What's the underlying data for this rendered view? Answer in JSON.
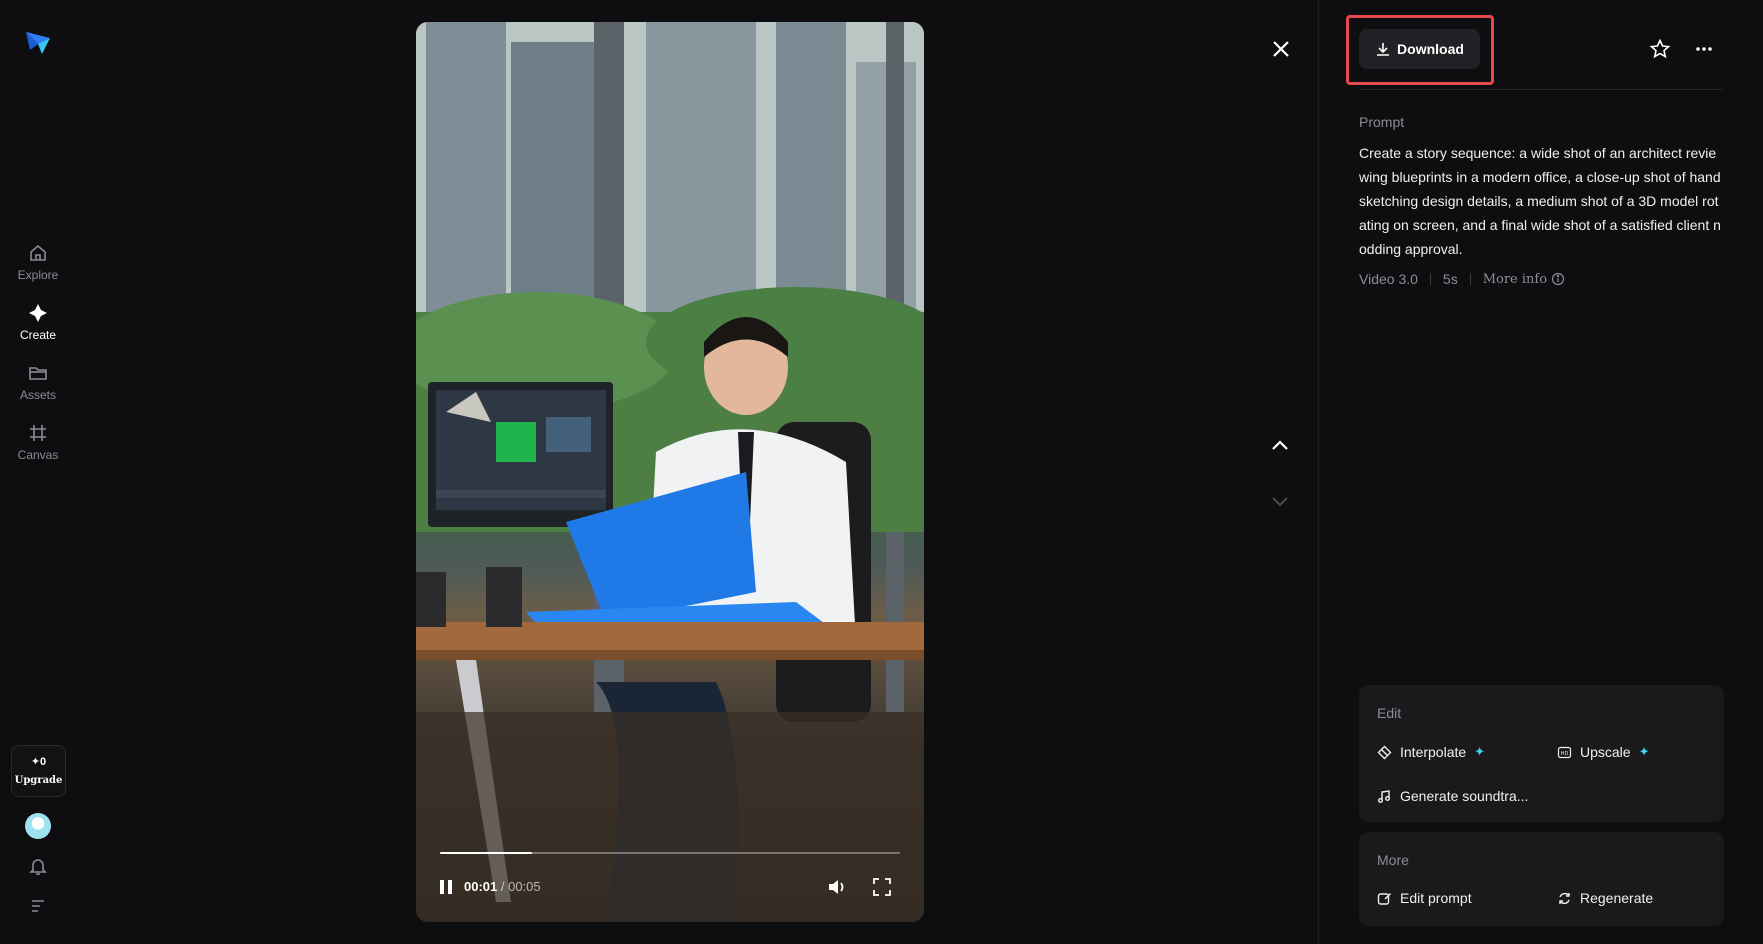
{
  "sidebar": {
    "items": [
      {
        "label": "Explore",
        "icon": "home-icon"
      },
      {
        "label": "Create",
        "icon": "sparkle-icon",
        "active": true
      },
      {
        "label": "Assets",
        "icon": "folder-icon"
      },
      {
        "label": "Canvas",
        "icon": "canvas-icon"
      }
    ],
    "upgrade": {
      "credits": "✦0",
      "label": "Upgrade"
    }
  },
  "player": {
    "current_time": "00:01",
    "duration": "/ 00:05",
    "progress": 0.2
  },
  "panel": {
    "download_label": "Download",
    "prompt_label": "Prompt",
    "prompt_text": "Create a story sequence: a wide shot of an architect reviewing blueprints in a modern office, a close-up shot of hand sketching design details, a medium shot of a 3D model rotating on screen, and a final wide shot of a satisfied client nodding approval.",
    "meta": {
      "model": "Video 3.0",
      "duration": "5s",
      "more_info": "More info"
    },
    "edit": {
      "title": "Edit",
      "interpolate": "Interpolate",
      "upscale": "Upscale",
      "soundtrack": "Generate soundtra..."
    },
    "more": {
      "title": "More",
      "edit_prompt": "Edit prompt",
      "regenerate": "Regenerate"
    }
  },
  "colors": {
    "accent": "#3fd3f0",
    "highlight": "#e5484d",
    "background": "#0e0e10"
  }
}
